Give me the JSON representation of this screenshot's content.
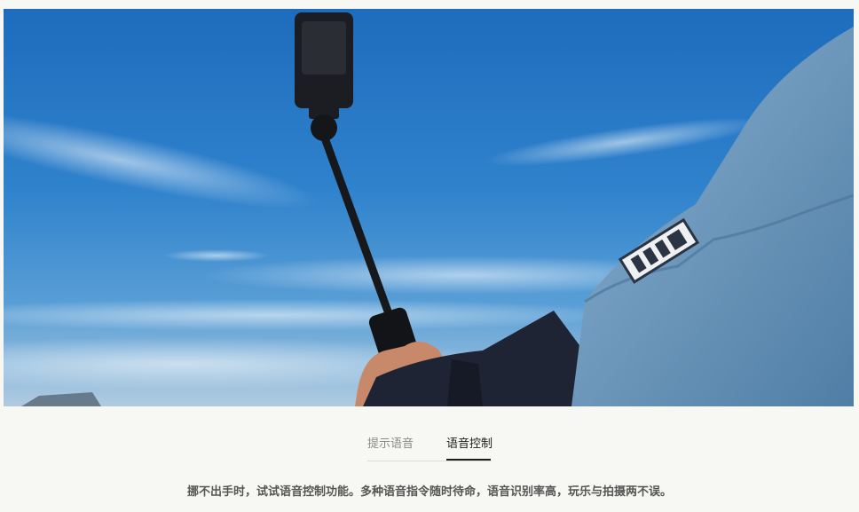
{
  "hero": {
    "image_alt": "",
    "colors": {
      "sky": "#2c7fca",
      "jacket": "#6f9cc0",
      "sleeve_dark": "#1e2434",
      "stick": "#16181c"
    }
  },
  "tabs": [
    {
      "label": "提示语音",
      "active": false
    },
    {
      "label": "语音控制",
      "active": true
    }
  ],
  "description": "挪不出手时，试试语音控制功能。多种语音指令随时待命，语音识别率高，玩乐与拍摄两不误。"
}
